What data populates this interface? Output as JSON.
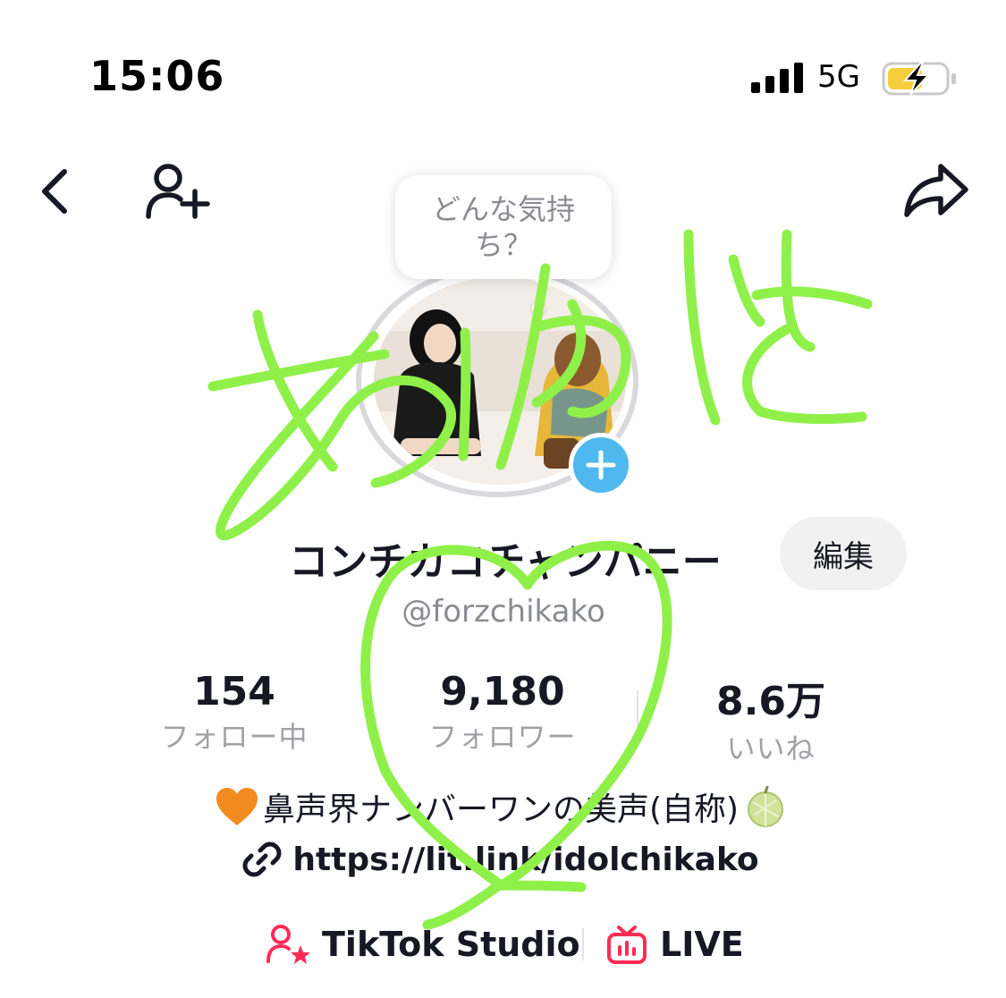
{
  "status_bar": {
    "time": "15:06",
    "network": "5G"
  },
  "tooltip": {
    "text": "どんな気持ち？"
  },
  "profile": {
    "name": "コンチカコチャンパニー",
    "edit_label": "編集",
    "handle": "@forzchikako"
  },
  "stats": [
    {
      "value": "154",
      "label": "フォロー中"
    },
    {
      "value": "9,180",
      "label": "フォロワー"
    },
    {
      "value": "8.6万",
      "label": "いいね"
    }
  ],
  "bio": {
    "text": "鼻声界ナンバーワンの美声(自称)",
    "link": "https://lit.link/idolchikako"
  },
  "bottom": {
    "studio_label": "TikTok Studio",
    "live_label": "LIVE"
  },
  "colors": {
    "scribble": "#8ff04a",
    "accent_red": "#fe2c55",
    "badge_blue": "#4fb8ef"
  },
  "icons": [
    "back-icon",
    "add-user-icon",
    "share-icon",
    "plus-icon",
    "link-icon",
    "studio-icon",
    "live-icon",
    "orange-heart-emoji",
    "melon-emoji"
  ]
}
